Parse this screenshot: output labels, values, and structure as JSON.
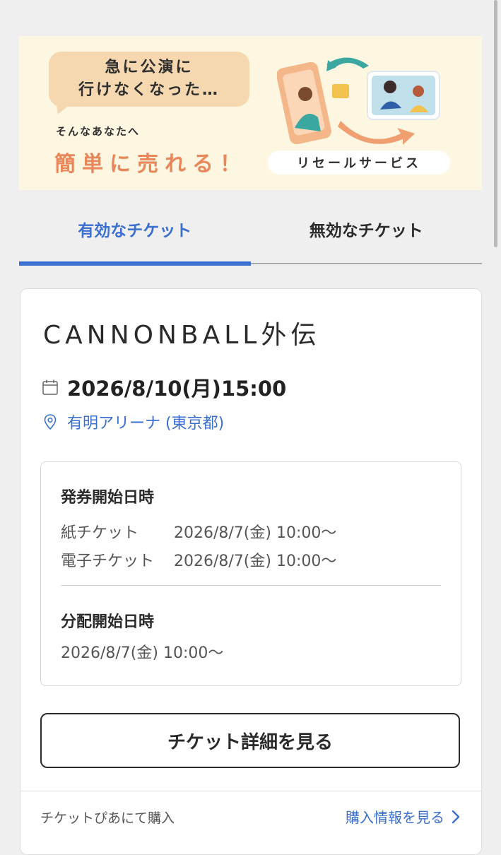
{
  "banner": {
    "bubble_line1": "急に公演に",
    "bubble_line2": "行けなくなった…",
    "sub": "そんなあなたへ",
    "main": "簡単に売れる！",
    "pill": "リセールサービス"
  },
  "tabs": [
    {
      "label": "有効なチケット",
      "active": true
    },
    {
      "label": "無効なチケット",
      "active": false
    }
  ],
  "event": {
    "title": "CANNONBALL外伝",
    "datetime": "2026/8/10(月)15:00",
    "venue": "有明アリーナ (東京都)"
  },
  "issue": {
    "heading": "発券開始日時",
    "rows": [
      {
        "label": "紙チケット",
        "value": "2026/8/7(金) 10:00〜"
      },
      {
        "label": "電子チケット",
        "value": "2026/8/7(金) 10:00〜"
      }
    ]
  },
  "distribution": {
    "heading": "分配開始日時",
    "value": "2026/8/7(金) 10:00〜"
  },
  "detail_button": "チケット詳細を見る",
  "footer": {
    "left": "チケットぴあにて購入",
    "right": "購入情報を見る"
  },
  "colors": {
    "accent": "#3b6fd0",
    "banner_bg": "#fdf7e2",
    "banner_orange": "#e9865a",
    "bubble": "#f6d8b0"
  }
}
